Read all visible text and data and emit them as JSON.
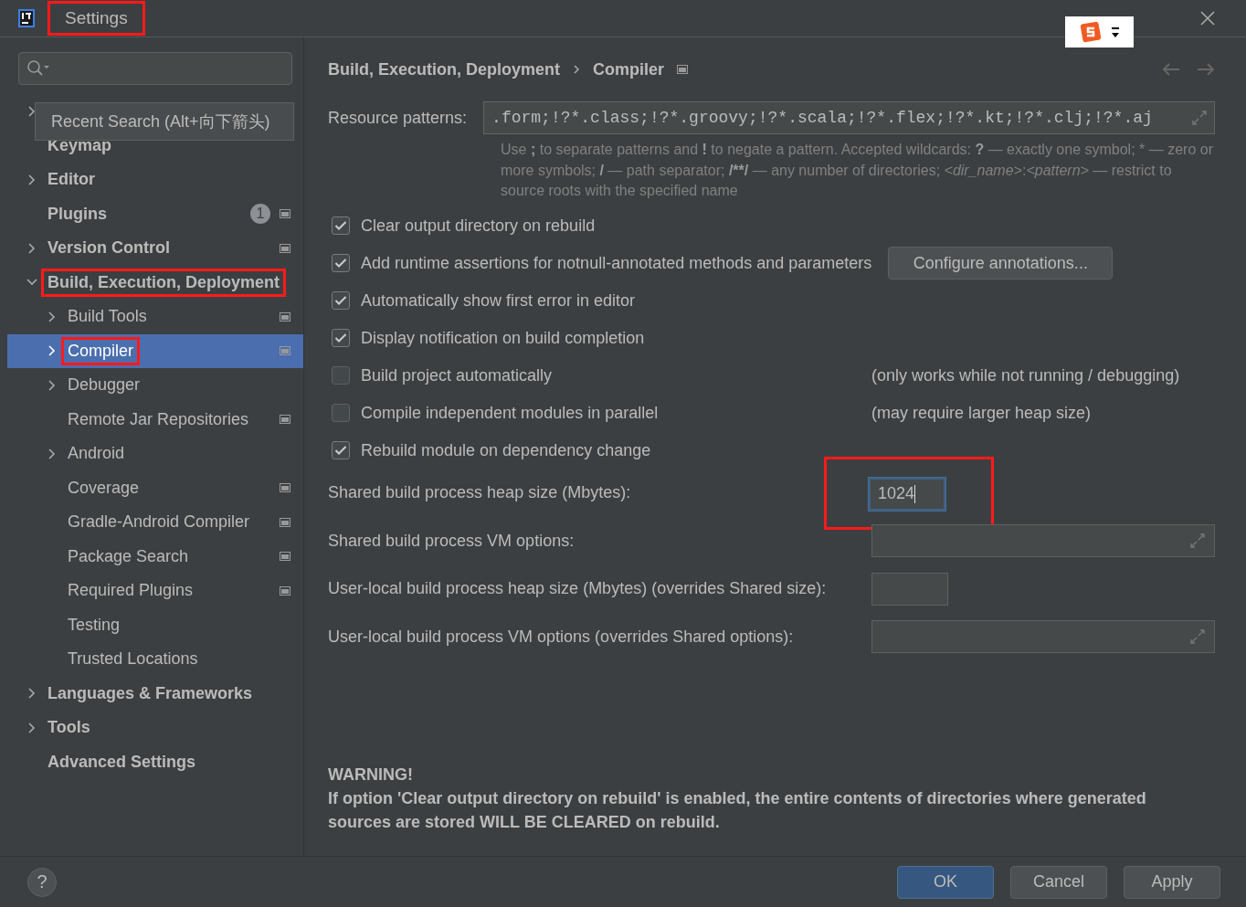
{
  "window": {
    "title": "Settings",
    "title_highlighted": true
  },
  "popup": {
    "text": "Recent Search (Alt+向下箭头)"
  },
  "sidebar": {
    "items": [
      {
        "kind": "covered",
        "expandable": true,
        "expanded": false,
        "selected": false
      },
      {
        "kind": "item",
        "label": "Keymap",
        "expandable": false,
        "expanded": false,
        "selected": false,
        "highlighted": false,
        "settings_icon": false
      },
      {
        "kind": "item",
        "label": "Editor",
        "expandable": true,
        "expanded": false,
        "selected": false,
        "highlighted": false,
        "settings_icon": false
      },
      {
        "kind": "item",
        "label": "Plugins",
        "badge": "1",
        "expandable": false,
        "expanded": false,
        "selected": false,
        "highlighted": false,
        "settings_icon": true
      },
      {
        "kind": "item",
        "label": "Version Control",
        "expandable": true,
        "expanded": false,
        "selected": false,
        "highlighted": false,
        "settings_icon": true
      },
      {
        "kind": "item",
        "label": "Build, Execution, Deployment",
        "expandable": true,
        "expanded": true,
        "selected": false,
        "highlighted": true,
        "settings_icon": false,
        "children": [
          {
            "kind": "item",
            "label": "Build Tools",
            "expandable": true,
            "expanded": false,
            "selected": false,
            "highlighted": false,
            "settings_icon": true
          },
          {
            "kind": "item",
            "label": "Compiler",
            "expandable": true,
            "expanded": false,
            "selected": true,
            "highlighted": true,
            "settings_icon": true
          },
          {
            "kind": "item",
            "label": "Debugger",
            "expandable": true,
            "expanded": false,
            "selected": false,
            "highlighted": false,
            "settings_icon": false
          },
          {
            "kind": "item",
            "label": "Remote Jar Repositories",
            "expandable": false,
            "expanded": false,
            "selected": false,
            "highlighted": false,
            "settings_icon": true
          },
          {
            "kind": "item",
            "label": "Android",
            "expandable": true,
            "expanded": false,
            "selected": false,
            "highlighted": false,
            "settings_icon": false
          },
          {
            "kind": "item",
            "label": "Coverage",
            "expandable": false,
            "expanded": false,
            "selected": false,
            "highlighted": false,
            "settings_icon": true
          },
          {
            "kind": "item",
            "label": "Gradle-Android Compiler",
            "expandable": false,
            "expanded": false,
            "selected": false,
            "highlighted": false,
            "settings_icon": true
          },
          {
            "kind": "item",
            "label": "Package Search",
            "expandable": false,
            "expanded": false,
            "selected": false,
            "highlighted": false,
            "settings_icon": true
          },
          {
            "kind": "item",
            "label": "Required Plugins",
            "expandable": false,
            "expanded": false,
            "selected": false,
            "highlighted": false,
            "settings_icon": true
          },
          {
            "kind": "item",
            "label": "Testing",
            "expandable": false,
            "expanded": false,
            "selected": false,
            "highlighted": false,
            "settings_icon": false
          },
          {
            "kind": "item",
            "label": "Trusted Locations",
            "expandable": false,
            "expanded": false,
            "selected": false,
            "highlighted": false,
            "settings_icon": false
          }
        ]
      },
      {
        "kind": "item",
        "label": "Languages & Frameworks",
        "expandable": true,
        "expanded": false,
        "selected": false,
        "highlighted": false,
        "settings_icon": false
      },
      {
        "kind": "item",
        "label": "Tools",
        "expandable": true,
        "expanded": false,
        "selected": false,
        "highlighted": false,
        "settings_icon": false
      },
      {
        "kind": "item",
        "label": "Advanced Settings",
        "expandable": false,
        "expanded": false,
        "selected": false,
        "highlighted": false,
        "settings_icon": false
      }
    ]
  },
  "breadcrumb": [
    "Build, Execution, Deployment",
    "Compiler"
  ],
  "resource_patterns": {
    "label": "Resource patterns:",
    "value": ".form;!?*.class;!?*.groovy;!?*.scala;!?*.flex;!?*.kt;!?*.clj;!?*.aj",
    "hint": [
      {
        "kind": "plain",
        "text": "Use "
      },
      {
        "kind": "bold",
        "text": ";"
      },
      {
        "kind": "plain",
        "text": " to separate patterns and "
      },
      {
        "kind": "bold",
        "text": "!"
      },
      {
        "kind": "plain",
        "text": " to negate a pattern. Accepted wildcards: "
      },
      {
        "kind": "bold",
        "text": "?"
      },
      {
        "kind": "plain",
        "text": " — exactly one symbol; * — zero or more symbols; "
      },
      {
        "kind": "bold",
        "text": "/"
      },
      {
        "kind": "plain",
        "text": " — path separator; "
      },
      {
        "kind": "bold",
        "text": "/**/"
      },
      {
        "kind": "plain",
        "text": " — any number of directories; "
      },
      {
        "kind": "italic",
        "text": "<dir_name>"
      },
      {
        "kind": "plain",
        "text": ":"
      },
      {
        "kind": "italic",
        "text": "<pattern>"
      },
      {
        "kind": "plain",
        "text": " — restrict to source roots with the specified name"
      }
    ]
  },
  "options": [
    {
      "label": "Clear output directory on rebuild",
      "checked": true
    },
    {
      "label": "Add runtime assertions for notnull-annotated methods and parameters",
      "checked": true,
      "button": "Configure annotations..."
    },
    {
      "label": "Automatically show first error in editor",
      "checked": true
    },
    {
      "label": "Display notification on build completion",
      "checked": true
    },
    {
      "label": "Build project automatically",
      "checked": false,
      "note": "(only works while not running / debugging)"
    },
    {
      "label": "Compile independent modules in parallel",
      "checked": false,
      "note": "(may require larger heap size)"
    },
    {
      "label": "Rebuild module on dependency change",
      "checked": true
    }
  ],
  "fields": [
    {
      "kind": "short",
      "label": "Shared build process heap size (Mbytes):",
      "value": "1024",
      "focused": true,
      "highlighted": true
    },
    {
      "kind": "expand",
      "label": "Shared build process VM options:"
    },
    {
      "kind": "short",
      "label": "User-local build process heap size (Mbytes) (overrides Shared size):",
      "focused": false,
      "highlighted": false
    },
    {
      "kind": "expand",
      "label": "User-local build process VM options (overrides Shared options):"
    }
  ],
  "warning": {
    "title": "WARNING!",
    "text": "If option 'Clear output directory on rebuild' is enabled, the entire contents of directories where generated sources are stored WILL BE CLEARED on rebuild."
  },
  "help": "?",
  "buttons": [
    {
      "label": "OK",
      "default": true
    },
    {
      "label": "Cancel",
      "default": false
    },
    {
      "label": "Apply",
      "default": false
    }
  ]
}
